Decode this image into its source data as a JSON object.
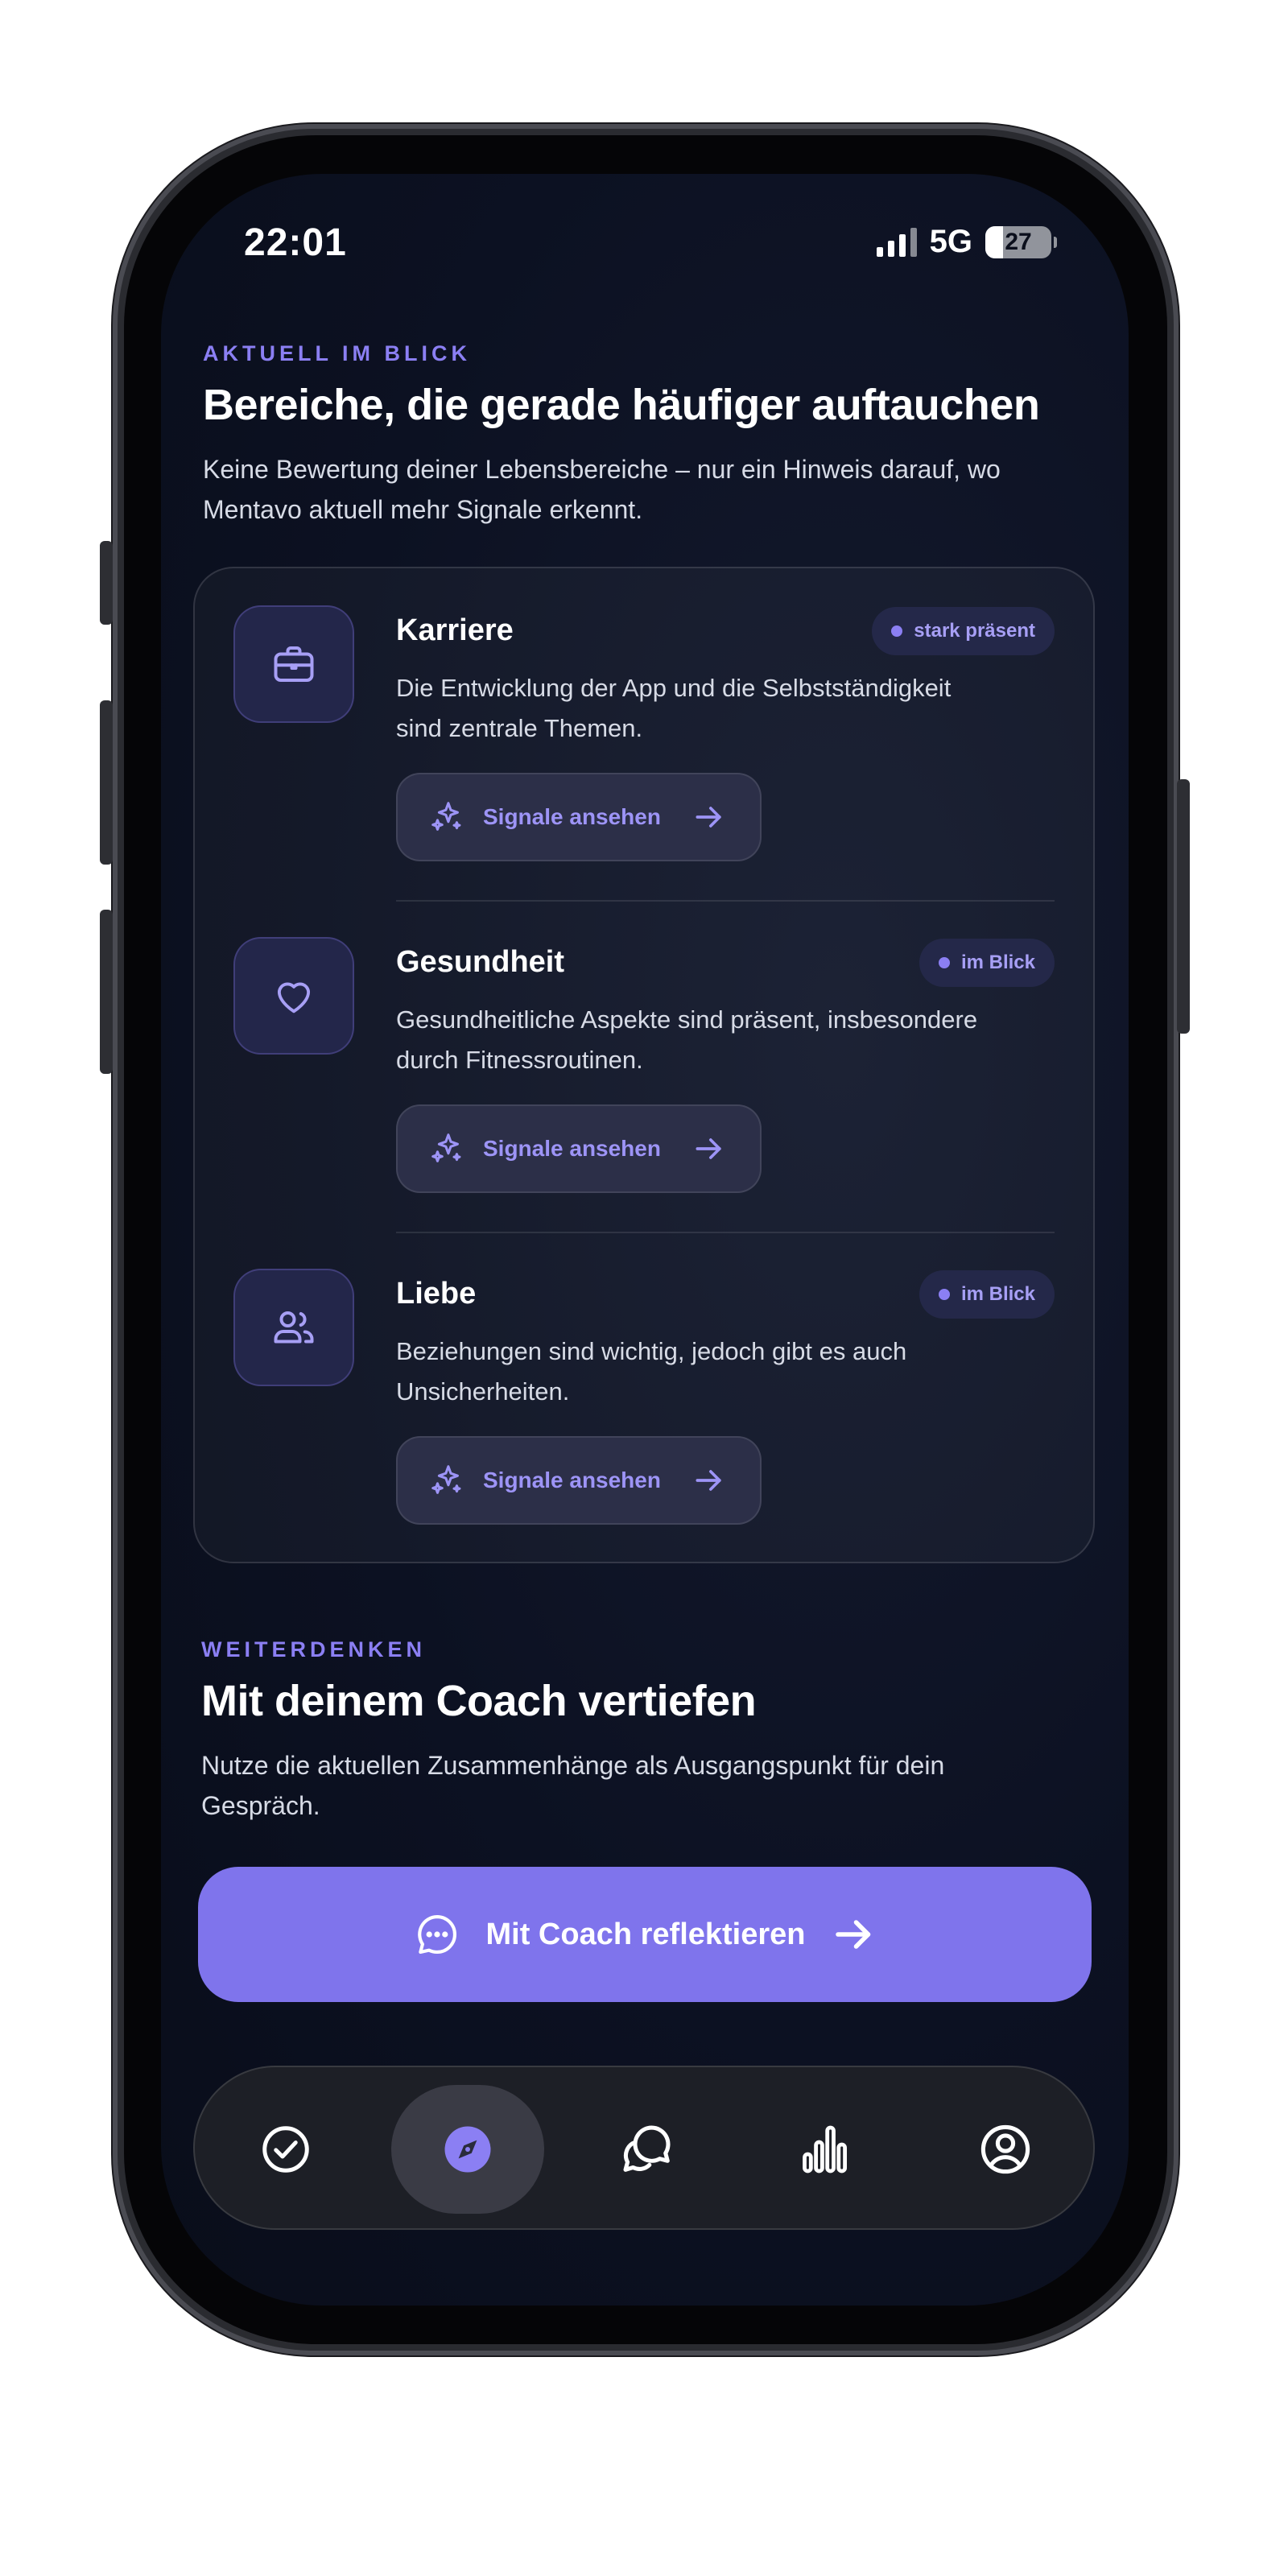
{
  "status_bar": {
    "time": "22:01",
    "network": "5G",
    "battery": "27"
  },
  "section_focus": {
    "eyebrow": "AKTUELL IM BLICK",
    "title": "Bereiche, die gerade häufiger auftauchen",
    "subtitle_line1": "Keine Bewertung deiner Lebensbereiche – nur ein Hinweis darauf, wo",
    "subtitle_line2": "Mentavo aktuell mehr Signale erkennt."
  },
  "areas": [
    {
      "title": "Karriere",
      "badge": "stark präsent",
      "icon": "briefcase-icon",
      "desc_line1": "Die Entwicklung der App und die Selbstständigkeit",
      "desc_line2": "sind zentrale Themen.",
      "button": "Signale ansehen"
    },
    {
      "title": "Gesundheit",
      "badge": "im Blick",
      "icon": "heart-icon",
      "desc_line1": "Gesundheitliche Aspekte sind präsent, insbesondere",
      "desc_line2": "durch Fitnessroutinen.",
      "button": "Signale ansehen"
    },
    {
      "title": "Liebe",
      "badge": "im Blick",
      "icon": "people-icon",
      "desc_line1": "Beziehungen sind wichtig, jedoch gibt es auch",
      "desc_line2": "Unsicherheiten.",
      "button": "Signale ansehen"
    }
  ],
  "section_coach": {
    "eyebrow": "WEITERDENKEN",
    "title": "Mit deinem Coach vertiefen",
    "subtitle_line1": "Nutze die aktuellen Zusammenhänge als Ausgangspunkt für dein",
    "subtitle_line2": "Gespräch.",
    "cta": "Mit Coach reflektieren"
  },
  "tab_bar": {
    "tabs": [
      "check-circle-icon",
      "compass-icon",
      "chat-bubbles-icon",
      "bar-chart-icon",
      "profile-icon"
    ],
    "active_index": 1
  },
  "colors": {
    "accent": "#8b7ff3",
    "cta": "#7f74ec",
    "screen_bg": "#0c1122",
    "badge_bg": "#242849"
  }
}
